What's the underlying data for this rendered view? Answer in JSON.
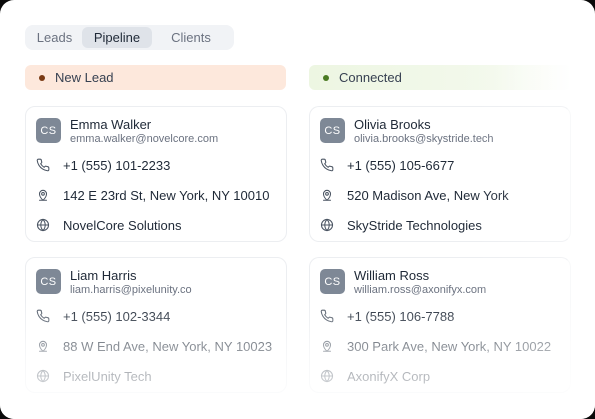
{
  "tabs": [
    {
      "label": "Leads"
    },
    {
      "label": "Pipeline",
      "active": true
    },
    {
      "label": "Clients"
    }
  ],
  "columns": [
    {
      "label": "New Lead",
      "accent": "#7a3a14",
      "background": "#fde8dc"
    },
    {
      "label": "Connected",
      "accent": "#4a7a22",
      "background": "#edf6e2"
    }
  ],
  "cards": [
    {
      "initials": "CS",
      "name": "Emma Walker",
      "email": "emma.walker@novelcore.com",
      "phone": "+1 (555) 101-2233",
      "address": "142 E 23rd St, New York, NY 10010",
      "company": "NovelCore Solutions"
    },
    {
      "initials": "CS",
      "name": "Olivia Brooks",
      "email": "olivia.brooks@skystride.tech",
      "phone": "+1 (555) 105-6677",
      "address": "520 Madison Ave, New York",
      "company": "SkyStride Technologies"
    },
    {
      "initials": "CS",
      "name": "Liam Harris",
      "email": "liam.harris@pixelunity.co",
      "phone": "+1 (555) 102-3344",
      "address": "88 W End Ave, New York, NY 10023",
      "company": "PixelUnity Tech"
    },
    {
      "initials": "CS",
      "name": "William Ross",
      "email": "william.ross@axonifyx.com",
      "phone": "+1 (555) 106-7788",
      "address": "300 Park Ave, New York, NY 10022",
      "company": "AxonifyX Corp"
    }
  ],
  "icons": {
    "phone": "phone-icon",
    "location": "map-pin-icon",
    "company": "globe-icon"
  }
}
